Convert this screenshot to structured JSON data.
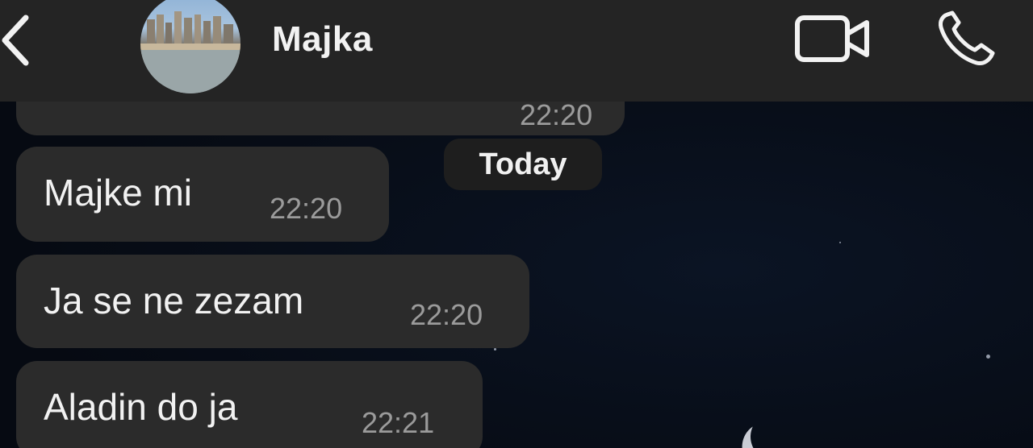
{
  "header": {
    "back_icon": "chevron-left-icon",
    "contact_name": "Majka",
    "video_icon": "video-camera-icon",
    "call_icon": "phone-icon"
  },
  "date_separator": "Today",
  "messages": [
    {
      "text": "",
      "time": "22:20"
    },
    {
      "text": "Majke mi",
      "time": "22:20"
    },
    {
      "text": "Ja se ne zezam",
      "time": "22:20"
    },
    {
      "text": "Aladin do ja",
      "time": "22:21"
    }
  ],
  "colors": {
    "header_bg": "#242424",
    "bubble_bg": "#2b2b2b",
    "background": "#070b14",
    "time_text": "#9b9b9b"
  }
}
